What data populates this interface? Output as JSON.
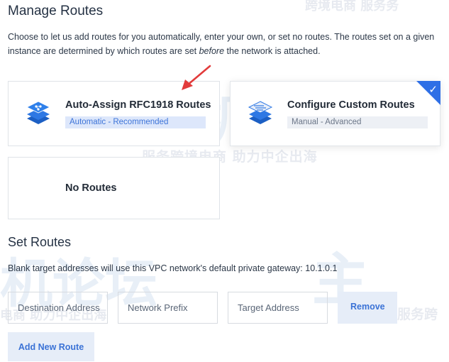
{
  "page": {
    "title": "Manage Routes",
    "description_pre": "Choose to let us add routes for you automatically, enter your own, or set no routes. The routes set on a given instance are determined by which routes are set ",
    "description_em": "before",
    "description_post": " the network is attached."
  },
  "watermarks": {
    "w1": "跨境电商    服务务",
    "w2": "服务跨境电商  助力中企出海",
    "w3": "服务跨",
    "w4": "电商  助力中企出海",
    "logo_a": "主机",
    "logo_b": "主",
    "logo_c": "机论坛"
  },
  "route_options": {
    "auto": {
      "title": "Auto-Assign RFC1918 Routes",
      "subtitle": "Automatic - Recommended",
      "icon": "network-stack-icon"
    },
    "custom": {
      "title": "Configure Custom Routes",
      "subtitle": "Manual - Advanced",
      "icon": "network-config-icon",
      "selected": true
    },
    "none": {
      "title": "No Routes"
    }
  },
  "set_routes": {
    "title": "Set Routes",
    "description": "Blank target addresses will use this VPC network's default private gateway: 10.1.0.1",
    "destination_placeholder": "Destination Address",
    "prefix_placeholder": "Network Prefix",
    "target_placeholder": "Target Address",
    "remove_label": "Remove",
    "add_label": "Add New Route"
  },
  "colors": {
    "accent": "#2e6fe6",
    "button_bg": "#e6edf8",
    "annotation_arrow": "#e23b3b"
  }
}
